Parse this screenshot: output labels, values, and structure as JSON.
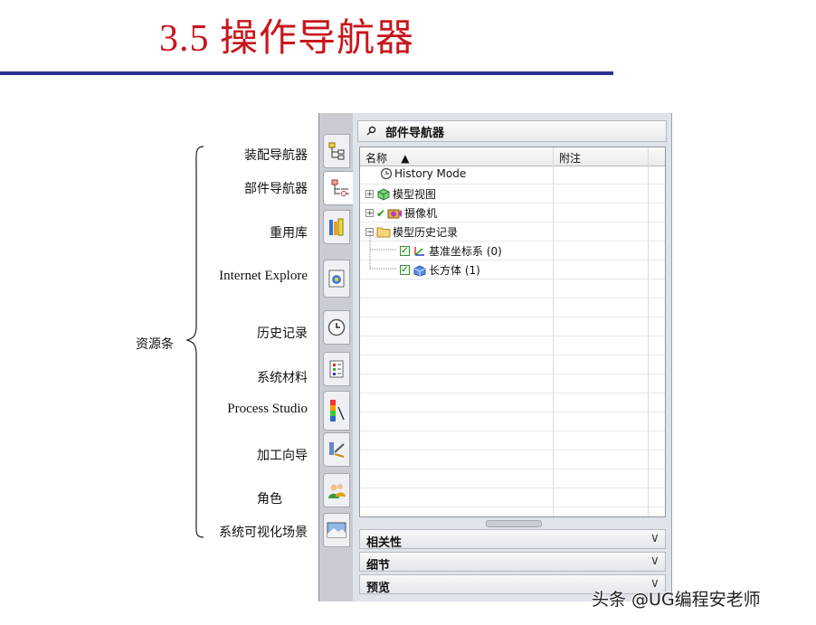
{
  "slide": {
    "title": "3.5  操作导航器"
  },
  "labels": {
    "resource_bar": "资源条",
    "items": [
      "装配导航器",
      "部件导航器",
      "重用库",
      "Internet Explore",
      "历史记录",
      "系统材料",
      "Process  Studio",
      "加工向导",
      "角色",
      "系统可视化场景"
    ]
  },
  "navigator": {
    "header": "部件导航器",
    "columns": {
      "name": "名称",
      "sort_glyph": "▲",
      "note": "附注"
    },
    "rows": [
      {
        "label": "History Mode",
        "expander": "",
        "checked": false,
        "icon": "clock-icon"
      },
      {
        "label": "模型视图",
        "expander": "+",
        "checked": false,
        "icon": "model-view-icon"
      },
      {
        "label": "摄像机",
        "expander": "+",
        "checked": true,
        "icon": "camera-icon"
      },
      {
        "label": "模型历史记录",
        "expander": "−",
        "checked": false,
        "icon": "folder-icon"
      },
      {
        "label": "基准坐标系 (0)",
        "expander": "",
        "checked": true,
        "icon": "datum-csys-icon"
      },
      {
        "label": "长方体 (1)",
        "expander": "",
        "checked": true,
        "icon": "block-icon"
      }
    ],
    "sections": [
      {
        "label": "相关性",
        "chevron": "∨"
      },
      {
        "label": "细节",
        "chevron": "∨"
      },
      {
        "label": "预览",
        "chevron": "∨"
      }
    ]
  },
  "watermark": "头条 @UG编程安老师",
  "colors": {
    "title": "#c8161d",
    "rule": "#2e3192"
  }
}
